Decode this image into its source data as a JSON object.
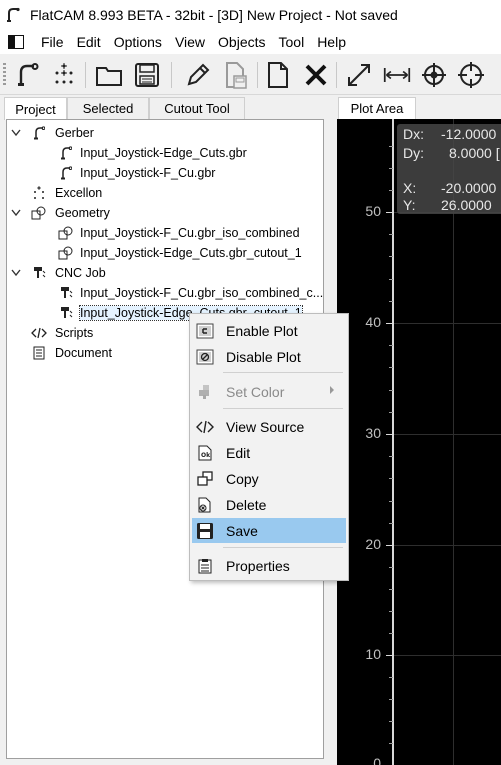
{
  "window": {
    "title": "FlatCAM 8.993 BETA - 32bit - [3D]    New Project - Not saved"
  },
  "menu": [
    "File",
    "Edit",
    "Options",
    "View",
    "Objects",
    "Tool",
    "Help"
  ],
  "toolbar": {
    "icons": [
      "gerber-icon",
      "excellon-icon",
      "open-folder-icon",
      "save-icon",
      "pencil-icon",
      "save-disabled-icon",
      "new-file-icon",
      "delete-x-icon",
      "zoom-fit-icon",
      "distance-icon",
      "target-icon",
      "crosshair-icon"
    ]
  },
  "left_tabs": [
    "Project",
    "Selected",
    "Cutout Tool"
  ],
  "tree": {
    "gerber": {
      "label": "Gerber",
      "children": [
        "Input_Joystick-Edge_Cuts.gbr",
        "Input_Joystick-F_Cu.gbr"
      ]
    },
    "excellon": {
      "label": "Excellon"
    },
    "geometry": {
      "label": "Geometry",
      "children": [
        "Input_Joystick-F_Cu.gbr_iso_combined",
        "Input_Joystick-Edge_Cuts.gbr_cutout_1"
      ]
    },
    "cncjob": {
      "label": "CNC Job",
      "children": [
        "Input_Joystick-F_Cu.gbr_iso_combined_c...",
        "Input_Joystick-Edge_Cuts.gbr_cutout_1"
      ]
    },
    "scripts": {
      "label": "Scripts"
    },
    "document": {
      "label": "Document"
    }
  },
  "plot": {
    "tab_label": "Plot Area",
    "readout": {
      "dx_label": "Dx:",
      "dx": "-12.0000",
      "dy_label": "Dy:",
      "dy": "8.0000 [",
      "x_label": "X:",
      "x": "-20.0000",
      "y_label": "Y:",
      "y": "26.0000"
    },
    "y_ticks": [
      "50",
      "40",
      "30",
      "20",
      "10",
      "0"
    ]
  },
  "context_menu": {
    "items": [
      {
        "label": "Enable Plot",
        "icon": "enable-plot-icon"
      },
      {
        "label": "Disable Plot",
        "icon": "disable-plot-icon"
      },
      {
        "label": "Set Color",
        "icon": "set-color-icon",
        "disabled": true
      },
      {
        "label": "View Source",
        "icon": "code-icon"
      },
      {
        "label": "Edit",
        "icon": "edit-icon"
      },
      {
        "label": "Copy",
        "icon": "copy-icon"
      },
      {
        "label": "Delete",
        "icon": "delete-icon"
      },
      {
        "label": "Save",
        "icon": "save-icon",
        "highlighted": true
      },
      {
        "label": "Properties",
        "icon": "properties-icon"
      }
    ]
  },
  "colors": {
    "highlight": "#99c9ef",
    "plot_background": "#000000"
  }
}
